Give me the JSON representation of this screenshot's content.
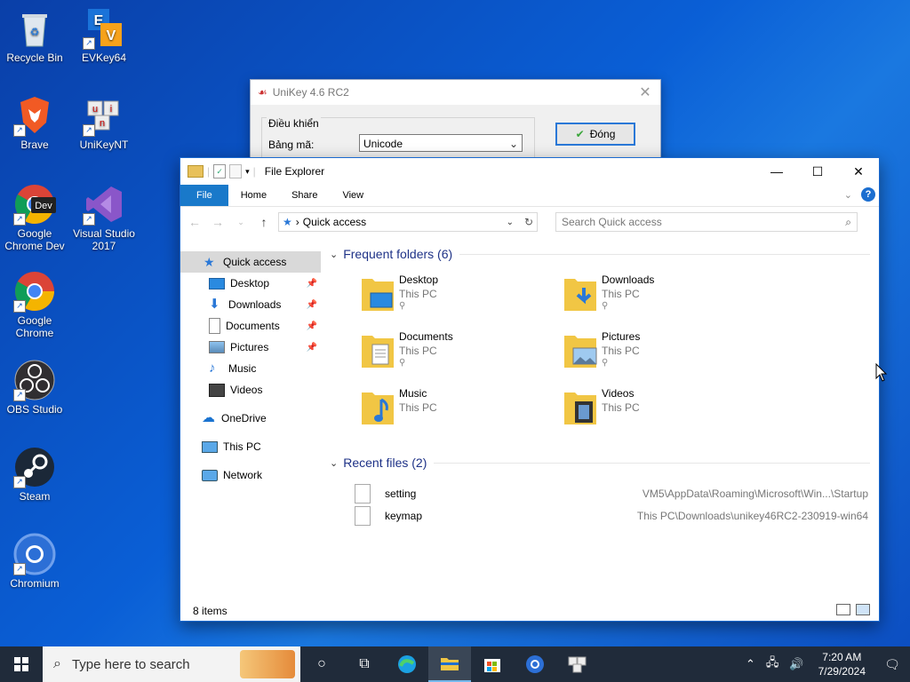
{
  "desktop": {
    "icons": [
      {
        "label": "Recycle Bin"
      },
      {
        "label": "EVKey64"
      },
      {
        "label": "Brave"
      },
      {
        "label": "UniKeyNT"
      },
      {
        "label": "Google Chrome Dev"
      },
      {
        "label": "Visual Studio 2017"
      },
      {
        "label": "Google Chrome"
      },
      {
        "label": "OBS Studio"
      },
      {
        "label": "Steam"
      },
      {
        "label": "Chromium"
      }
    ],
    "chrome_dev_badge": "Dev"
  },
  "unikey": {
    "title": "UniKey 4.6 RC2",
    "group_title": "Điều khiển",
    "charset_label": "Bảng mã:",
    "charset_value": "Unicode",
    "close_button": "Đóng"
  },
  "explorer": {
    "title": "File Explorer",
    "ribbon_tabs": [
      "File",
      "Home",
      "Share",
      "View"
    ],
    "address": "Quick access",
    "search_placeholder": "Search Quick access",
    "nav": {
      "quick_access": "Quick access",
      "items": [
        "Desktop",
        "Downloads",
        "Documents",
        "Pictures",
        "Music",
        "Videos"
      ],
      "onedrive": "OneDrive",
      "this_pc": "This PC",
      "network": "Network"
    },
    "frequent_header": "Frequent folders (6)",
    "folders": [
      {
        "name": "Desktop",
        "loc": "This PC",
        "pinned": true
      },
      {
        "name": "Downloads",
        "loc": "This PC",
        "pinned": true
      },
      {
        "name": "Documents",
        "loc": "This PC",
        "pinned": true
      },
      {
        "name": "Pictures",
        "loc": "This PC",
        "pinned": true
      },
      {
        "name": "Music",
        "loc": "This PC",
        "pinned": false
      },
      {
        "name": "Videos",
        "loc": "This PC",
        "pinned": false
      }
    ],
    "recent_header": "Recent files (2)",
    "recent": [
      {
        "name": "setting",
        "path": "VM5\\AppData\\Roaming\\Microsoft\\Win...\\Startup"
      },
      {
        "name": "keymap",
        "path": "This PC\\Downloads\\unikey46RC2-230919-win64"
      }
    ],
    "status": "8 items"
  },
  "taskbar": {
    "search_placeholder": "Type here to search",
    "time": "7:20 AM",
    "date": "7/29/2024"
  }
}
